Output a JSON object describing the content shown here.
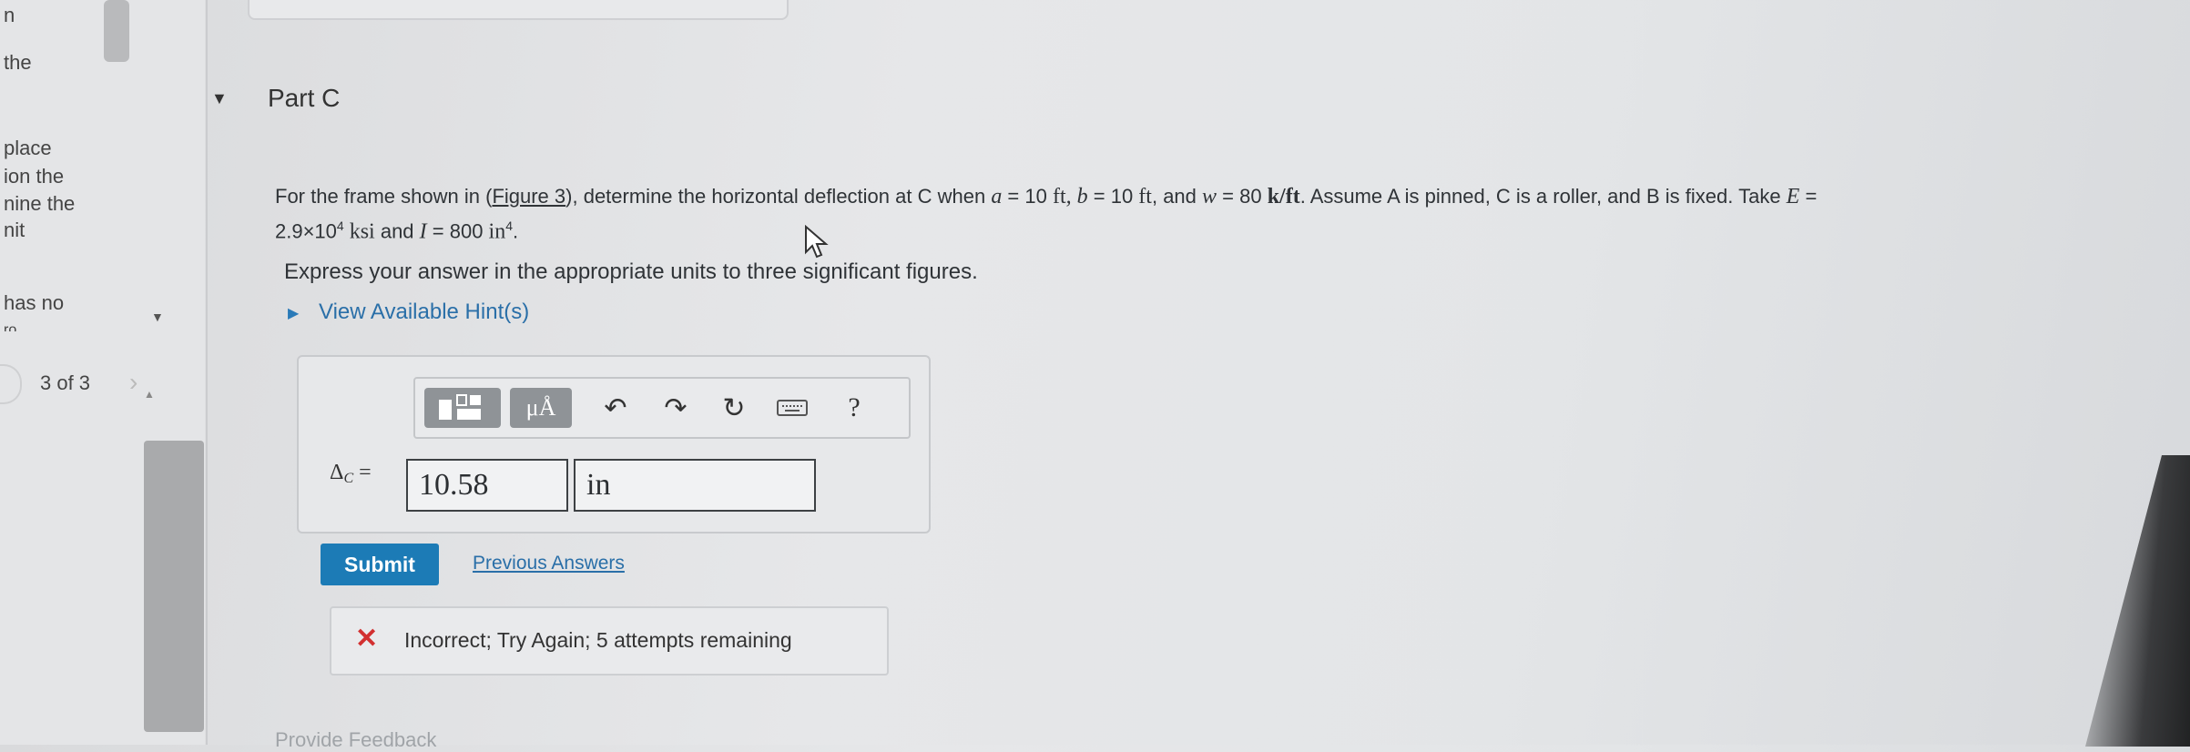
{
  "sidebar": {
    "fragments": [
      "n",
      "the",
      "place",
      "ion the",
      "nine the",
      "nit",
      "has no",
      "ro"
    ],
    "nav": {
      "count": "3 of 3"
    }
  },
  "part": {
    "title": "Part C"
  },
  "question": {
    "prefix": "For the frame shown in (",
    "figure_link": "Figure 3",
    "mid1": "), determine the horizontal deflection at C when ",
    "a_var": "a",
    "a_val": " = 10 ",
    "a_unit": "ft",
    "b_var": ", b",
    "b_val": " = 10 ",
    "b_unit": "ft",
    "w_text": ", and ",
    "w_var": "w",
    "w_val": " = 80 ",
    "w_unit": "k/ft",
    "assume": ". Assume A is pinned, C is a roller, and B is fixed. Take ",
    "E_var": "E",
    "E_eq": " = ",
    "E_val": "2.9×10",
    "E_exp": "4",
    "E_unit": " ksi",
    "and_I": " and ",
    "I_var": "I",
    "I_val": " = 800 ",
    "I_unit": "in",
    "I_exp": "4",
    "end": "."
  },
  "instruction": "Express your answer in the appropriate units to three significant figures.",
  "hint": {
    "label": "View Available Hint(s)"
  },
  "answer": {
    "toolbar": {
      "units_label": "μÅ",
      "help_label": "?"
    },
    "label": "Δ",
    "label_sub": "C",
    "label_eq": " =",
    "value": "10.58",
    "unit": "in"
  },
  "actions": {
    "submit_label": "Submit",
    "previous_answers_label": "Previous Answers"
  },
  "feedback": {
    "icon": "✕",
    "message": "Incorrect; Try Again; 5 attempts remaining"
  },
  "footer": {
    "provide_feedback": "Provide Feedback"
  },
  "colors": {
    "accent": "#1c7bb6",
    "error": "#d23030",
    "link": "#2a6fa8"
  }
}
